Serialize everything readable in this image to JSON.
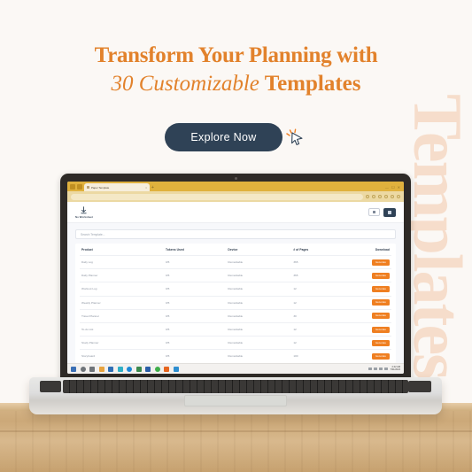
{
  "watermark_text": "Templates",
  "headline": {
    "line1": "Transform Your Planning with",
    "line2_italic": "30 Customizable",
    "line2_bold": "Templates"
  },
  "cta": {
    "label": "Explore Now",
    "cursor_icon": "mouse-pointer-icon"
  },
  "colors": {
    "accent_orange": "#e2822c",
    "button_orange": "#ef7f21",
    "navy": "#2f4256",
    "watermark_peach": "#f6ddcb",
    "background": "#fbf8f5",
    "browser_gold": "#e0b13d"
  },
  "browser": {
    "tab_title": "Paper Template",
    "tab_close_glyph": "×",
    "new_tab_glyph": "+",
    "window_controls": "— ☐ ✕",
    "url_text": "",
    "toolbar_icons": [
      "share-icon",
      "star-icon",
      "history-icon",
      "split-screen-icon",
      "extensions-icon",
      "profile-icon"
    ]
  },
  "app": {
    "brand_name": "No Worksheet",
    "brand_icon": "download-arrow-icon",
    "header_buttons": [
      {
        "name": "panel-toggle-button",
        "icon": "panel-icon"
      },
      {
        "name": "primary-action-button",
        "icon": "grid-icon"
      }
    ],
    "search": {
      "placeholder": "Search Template...",
      "value": ""
    },
    "table": {
      "columns": [
        "Product",
        "Tokens Used",
        "Device",
        "# of Pages",
        "Download"
      ],
      "rows": [
        {
          "product": "Daily Log",
          "tokens": "0/5",
          "device": "Remarkable",
          "pages": "365",
          "download": "Generate"
        },
        {
          "product": "Daily Planner",
          "tokens": "0/5",
          "device": "Remarkable",
          "pages": "365",
          "download": "Generate"
        },
        {
          "product": "Workout Log",
          "tokens": "0/5",
          "device": "Remarkable",
          "pages": "12",
          "download": "Generate"
        },
        {
          "product": "Weekly Planner",
          "tokens": "0/5",
          "device": "Remarkable",
          "pages": "12",
          "download": "Generate"
        },
        {
          "product": "Travel Planner",
          "tokens": "0/5",
          "device": "Remarkable",
          "pages": "30",
          "download": "Generate"
        },
        {
          "product": "To-do List",
          "tokens": "0/5",
          "device": "Remarkable",
          "pages": "12",
          "download": "Generate"
        },
        {
          "product": "Study Planner",
          "tokens": "0/5",
          "device": "Remarkable",
          "pages": "12",
          "download": "Generate"
        },
        {
          "product": "Storyboard",
          "tokens": "0/5",
          "device": "Remarkable",
          "pages": "100",
          "download": "Generate"
        }
      ]
    }
  },
  "taskbar": {
    "apps": [
      {
        "name": "start-button",
        "color": "#3b6fb5"
      },
      {
        "name": "search-icon",
        "color": "#6f7479"
      },
      {
        "name": "task-view-icon",
        "color": "#6f7479"
      },
      {
        "name": "file-explorer-icon",
        "color": "#e8a33d"
      },
      {
        "name": "store-icon",
        "color": "#2f6fb5"
      },
      {
        "name": "mail-icon",
        "color": "#31b0c6"
      },
      {
        "name": "edge-icon",
        "color": "#1e88d6"
      },
      {
        "name": "excel-icon",
        "color": "#3c8a4e"
      },
      {
        "name": "word-icon",
        "color": "#2b5fa8"
      },
      {
        "name": "whatsapp-icon",
        "color": "#3fae4b"
      },
      {
        "name": "vlc-icon",
        "color": "#e6651f"
      },
      {
        "name": "teams-icon",
        "color": "#2e8ed0"
      }
    ],
    "tray": {
      "time": "2:42 AM",
      "date": "7/31/2024"
    }
  }
}
